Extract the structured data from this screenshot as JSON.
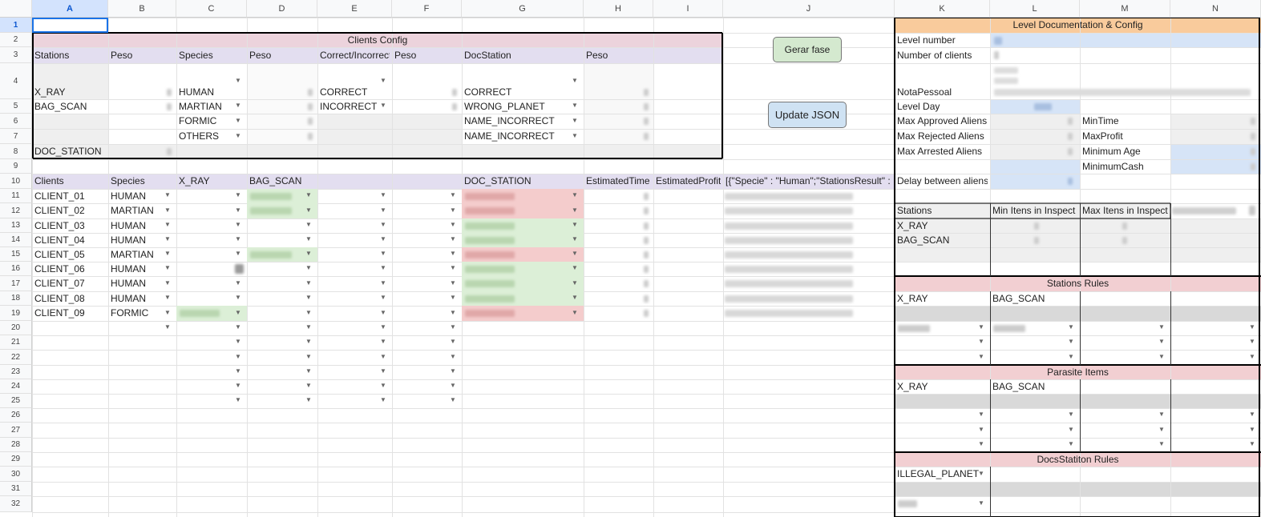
{
  "columns": [
    "A",
    "B",
    "C",
    "D",
    "E",
    "F",
    "G",
    "H",
    "I",
    "J",
    "K",
    "L",
    "M",
    "N"
  ],
  "rows": [
    "1",
    "2",
    "3",
    "4",
    "5",
    "6",
    "7",
    "8",
    "9",
    "10",
    "11",
    "12",
    "13",
    "14",
    "15",
    "16",
    "17",
    "18",
    "19",
    "20",
    "21",
    "22",
    "23",
    "24",
    "25",
    "26",
    "27",
    "28",
    "29",
    "30",
    "31",
    "32"
  ],
  "clients_config": {
    "title": "Clients Config",
    "headers": [
      "Stations",
      "Peso",
      "Species",
      "Peso",
      "Correct/Incorrect",
      "Peso",
      "DocStation",
      "Peso"
    ],
    "stations": [
      "X_RAY",
      "BAG_SCAN",
      "DOC_STATION"
    ],
    "species": [
      "HUMAN",
      "MARTIAN",
      "FORMIC",
      "OTHERS"
    ],
    "correct_incorrect": [
      "CORRECT",
      "INCORRECT"
    ],
    "doc_station": [
      "CORRECT",
      "WRONG_PLANET",
      "NAME_INCORRECT",
      "NAME_INCORRECT"
    ]
  },
  "buttons": {
    "gerar_fase": "Gerar fase",
    "update_json": "Update JSON"
  },
  "clients_table": {
    "headers": [
      "Clients",
      "Species",
      "X_RAY",
      "BAG_SCAN",
      "DOC_STATION",
      "EstimatedTime",
      "EstimatedProfit"
    ],
    "json_preview": "[{\"Specie\" : \"Human\";\"StationsResult\" : [\"",
    "rows": [
      {
        "client": "CLIENT_01",
        "species": "HUMAN"
      },
      {
        "client": "CLIENT_02",
        "species": "MARTIAN"
      },
      {
        "client": "CLIENT_03",
        "species": "HUMAN"
      },
      {
        "client": "CLIENT_04",
        "species": "HUMAN"
      },
      {
        "client": "CLIENT_05",
        "species": "MARTIAN"
      },
      {
        "client": "CLIENT_06",
        "species": "HUMAN"
      },
      {
        "client": "CLIENT_07",
        "species": "HUMAN"
      },
      {
        "client": "CLIENT_08",
        "species": "HUMAN"
      },
      {
        "client": "CLIENT_09",
        "species": "FORMIC"
      }
    ]
  },
  "level_doc": {
    "title": "Level Documentation & Config",
    "fields": [
      "Level number",
      "Number of clients",
      "NotaPessoal",
      "Level Day",
      "Max Approved Aliens",
      "Max Rejected Aliens",
      "Max Arrested Aliens",
      "",
      "Delay between aliens"
    ],
    "right_fields": [
      "MinTime",
      "MaxProfit",
      "Minimum Age",
      "MinimumCash"
    ],
    "stations_header": [
      "Stations",
      "Min Itens in Inspect",
      "Max Itens in Inspect"
    ],
    "stations": [
      "X_RAY",
      "BAG_SCAN"
    ]
  },
  "stations_rules": {
    "title": "Stations Rules",
    "cols": [
      "X_RAY",
      "BAG_SCAN"
    ]
  },
  "parasite_items": {
    "title": "Parasite Items",
    "cols": [
      "X_RAY",
      "BAG_SCAN"
    ]
  },
  "docs_rules": {
    "title": "DocsStatiton Rules",
    "item": "ILLEGAL_PLANET"
  }
}
